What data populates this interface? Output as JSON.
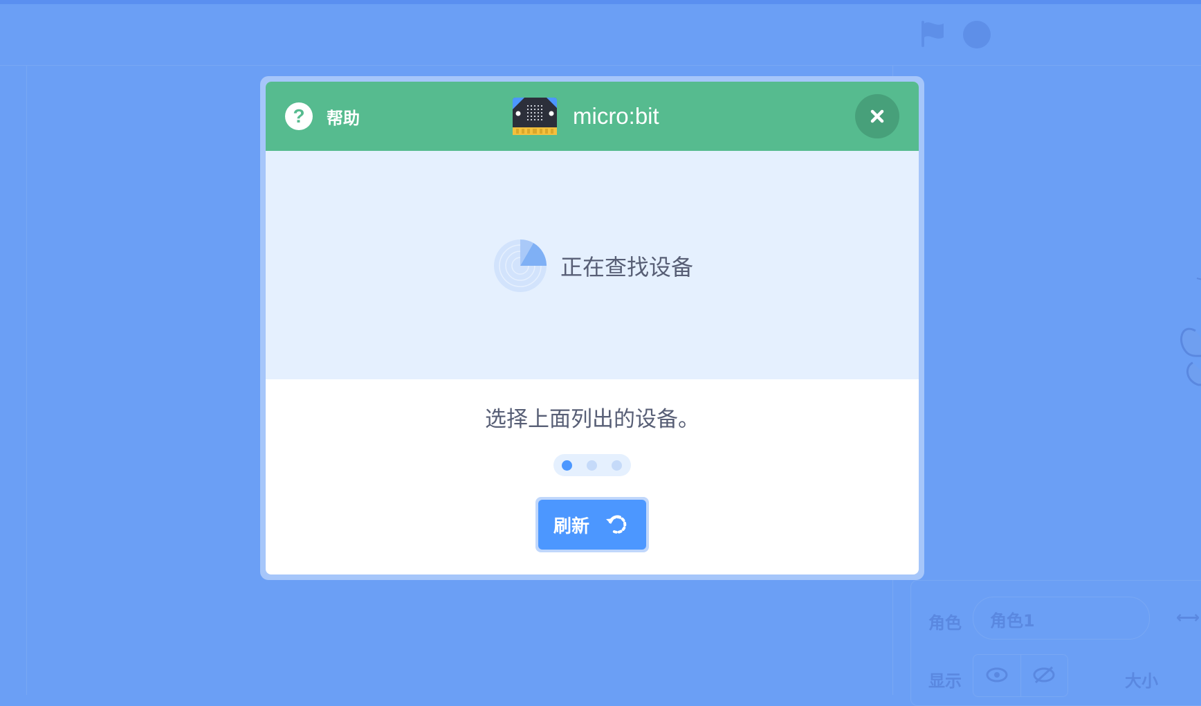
{
  "background": {
    "sprite_label": "角色",
    "sprite_name_value": "角色1",
    "show_label": "显示",
    "size_label": "大小"
  },
  "modal": {
    "help_label": "帮助",
    "title": "micro:bit",
    "scanning_text": "正在查找设备",
    "instruction": "选择上面列出的设备。",
    "step_count": 3,
    "active_step": 1,
    "refresh_label": "刷新",
    "icons": {
      "help": "help-icon",
      "device": "microbit-device-icon",
      "close": "close-icon",
      "scan": "radar-icon",
      "refresh": "refresh-icon"
    }
  },
  "colors": {
    "overlay": "#6b9ff5",
    "header": "#56bb8f",
    "close_button": "#47a07a",
    "scan_area": "#e5f0fe",
    "primary": "#4c97ff",
    "text": "#575e75"
  }
}
